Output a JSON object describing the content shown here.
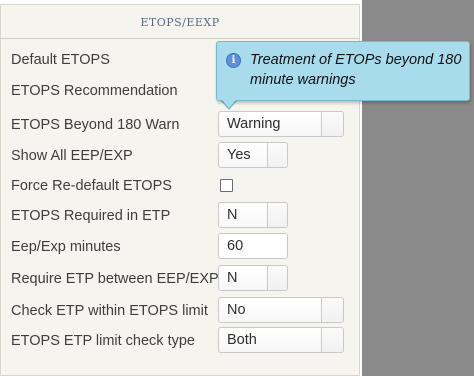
{
  "header": {
    "title": "ETOPS/EEXP"
  },
  "tooltip": {
    "icon": "info-icon",
    "text": "Treatment of ETOPs beyond 180 minute warnings"
  },
  "rows": [
    {
      "label": "Default ETOPS",
      "value": ""
    },
    {
      "label": "ETOPS Recommendation",
      "value": ""
    },
    {
      "label": "ETOPS Beyond 180 Warn",
      "value": "Warning"
    },
    {
      "label": "Show All EEP/EXP",
      "value": "Yes"
    },
    {
      "label": "Force Re-default ETOPS",
      "checked": false
    },
    {
      "label": "ETOPS Required in ETP",
      "value": "N"
    },
    {
      "label": "Eep/Exp minutes",
      "value": "60"
    },
    {
      "label": "Require ETP between EEP/EXP",
      "value": "N"
    },
    {
      "label": "Check ETP within ETOPS limit",
      "value": "No"
    },
    {
      "label": "ETOPS ETP limit check type",
      "value": "Both"
    }
  ]
}
